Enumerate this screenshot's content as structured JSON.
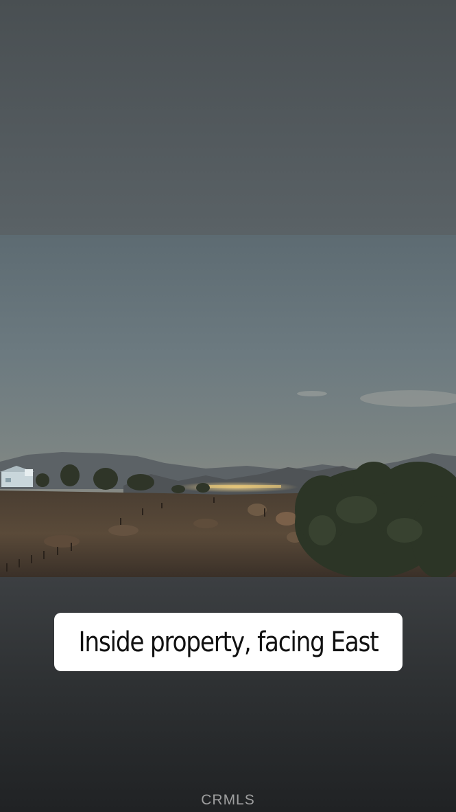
{
  "caption": {
    "text": "Inside property, facing East"
  },
  "watermark": {
    "text": "CRMLS"
  },
  "colors": {
    "caption_background": "#ffffff",
    "caption_text": "#111111",
    "background_top": "#4f5559",
    "background_bottom": "#202224"
  }
}
